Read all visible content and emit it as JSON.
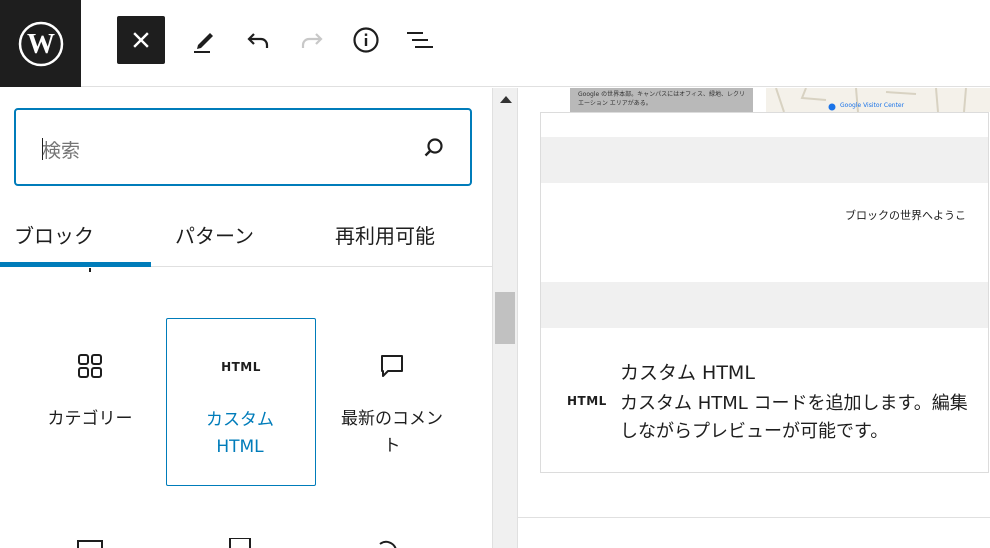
{
  "toolbar": {
    "logo_icon": "wordpress-logo",
    "close_icon": "close-icon",
    "edit_icon": "pencil-icon",
    "undo_icon": "undo-icon",
    "redo_icon": "redo-icon",
    "info_icon": "info-icon",
    "list_view_icon": "list-view-icon"
  },
  "search": {
    "placeholder": "検索"
  },
  "tabs": [
    {
      "label": "ブロック",
      "active": true
    },
    {
      "label": "パターン",
      "active": false
    },
    {
      "label": "再利用可能",
      "active": false
    }
  ],
  "blocks": [
    {
      "label": "カテゴリー",
      "icon": "categories-icon",
      "selected": false
    },
    {
      "label": "カスタム HTML",
      "icon": "html-icon",
      "icon_text": "HTML",
      "selected": true
    },
    {
      "label": "最新のコメント",
      "icon": "comment-icon",
      "selected": false
    }
  ],
  "preview": {
    "map_caption": "Google の世界本部。キャンパスにはオフィス、緑地、レクリエーション エリアがある。",
    "map_label": "Google Visitor Center",
    "world_text": "ブロックの世界へようこ",
    "icon_text": "HTML",
    "title": "カスタム HTML",
    "description": "カスタム HTML コードを追加します。編集しながらプレビューが可能です。"
  },
  "colors": {
    "accent": "#007cba",
    "dark": "#1e1e1e",
    "border": "#e0e0e0"
  }
}
